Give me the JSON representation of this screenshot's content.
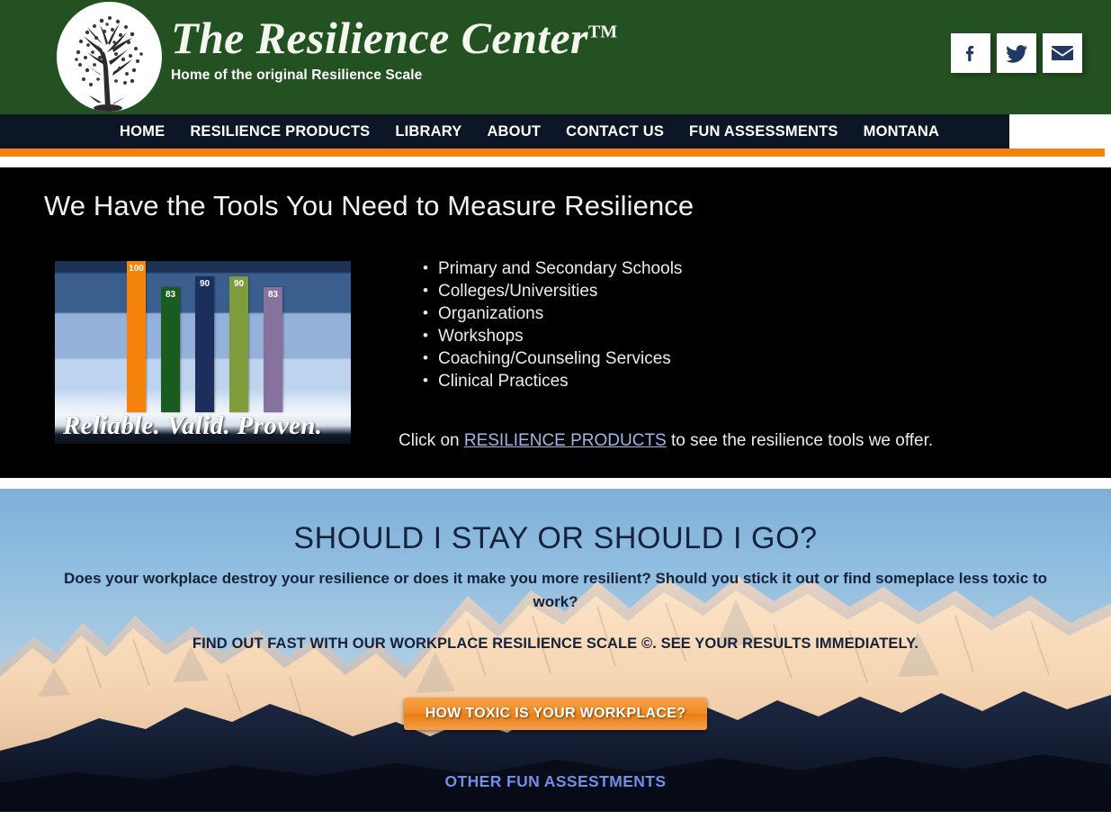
{
  "header": {
    "logo_icon": "tree-logo-icon",
    "title": "The Resilience Center",
    "trademark": "TM",
    "tagline": "Home of the original Resilience Scale",
    "social": [
      {
        "name": "facebook-icon",
        "label": "Facebook"
      },
      {
        "name": "twitter-icon",
        "label": "Twitter"
      },
      {
        "name": "email-icon",
        "label": "Email"
      }
    ],
    "colors": {
      "background": "#235121",
      "text": "#f4f7f0"
    }
  },
  "nav": {
    "items": [
      {
        "label": "HOME"
      },
      {
        "label": "RESILIENCE PRODUCTS"
      },
      {
        "label": "LIBRARY"
      },
      {
        "label": "ABOUT"
      },
      {
        "label": "CONTACT US"
      },
      {
        "label": "FUN ASSESSMENTS"
      },
      {
        "label": "MONTANA"
      }
    ],
    "colors": {
      "background": "#0d1626",
      "accent": "#f5820b",
      "text": "#ffffff"
    }
  },
  "hero": {
    "title": "We Have the Tools You Need to Measure Resilience",
    "list": [
      "Primary and Secondary Schools",
      "Colleges/Universities",
      "Organizations",
      "Workshops",
      "Coaching/Counseling Services",
      "Clinical Practices"
    ],
    "cta_prefix": "Click on ",
    "cta_link": "RESILIENCE PRODUCTS",
    "cta_suffix": " to see the resilience tools we offer.",
    "background": "#000000"
  },
  "chart_data": {
    "type": "bar",
    "title": "",
    "caption": "Reliable. Valid. Proven.",
    "categories": [
      "Bar 1",
      "Bar 2",
      "Bar 3",
      "Bar 4",
      "Bar 5"
    ],
    "values": [
      100,
      83,
      90,
      90,
      83
    ],
    "labels": [
      "100",
      "83",
      "90",
      "90",
      "83"
    ],
    "colors": [
      "#f5820b",
      "#1a5c20",
      "#1c2f5c",
      "#7f9c3c",
      "#87729e"
    ],
    "xlabel": "",
    "ylabel": "",
    "ylim": [
      0,
      100
    ],
    "grid": false,
    "legend": "none"
  },
  "promo": {
    "title": "SHOULD I STAY OR SHOULD I GO?",
    "paragraph": "Does your workplace destroy your resilience or does it make you more resilient? Should you stick it out or find someplace less toxic to work?",
    "bold_line": "FIND OUT FAST WITH OUR WORKPLACE RESILIENCE SCALE ©. SEE YOUR RESULTS IMMEDIATELY.",
    "button_label": "HOW TOXIC IS YOUR WORKPLACE?",
    "link_label": "OTHER FUN ASSESTMENTS",
    "colors": {
      "button": "#f18b22",
      "link": "#6f8fe8",
      "text": "#15223c"
    }
  }
}
